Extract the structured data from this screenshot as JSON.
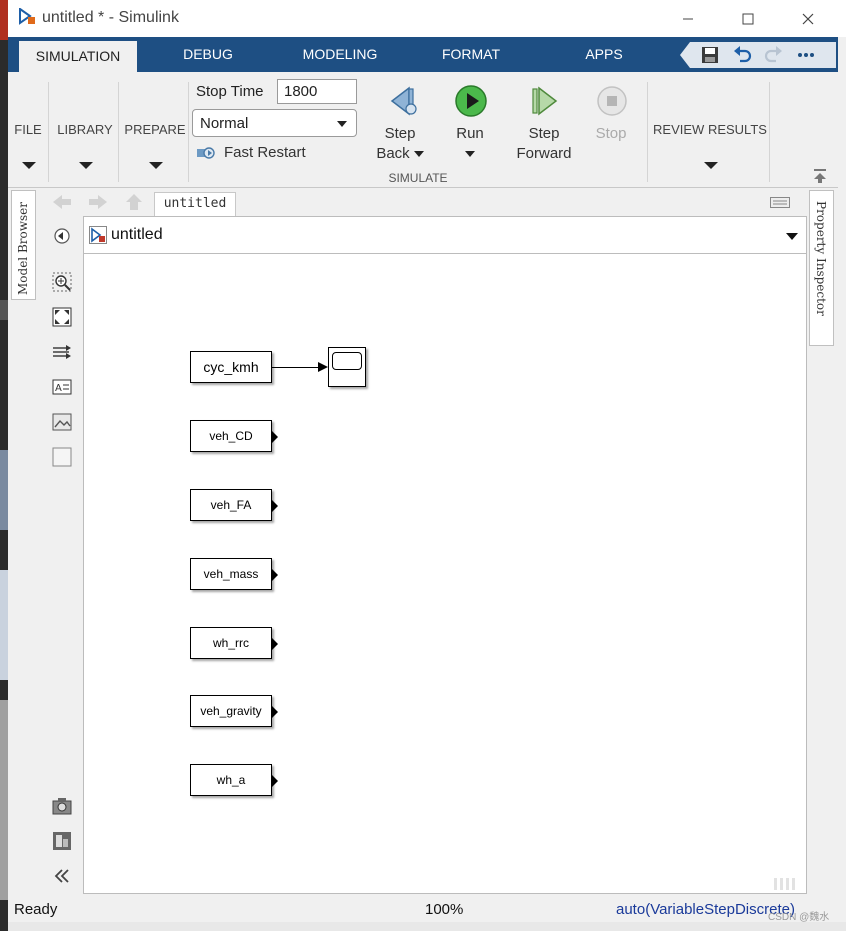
{
  "window": {
    "title": "untitled * - Simulink"
  },
  "tabs": [
    {
      "label": "SIMULATION",
      "active": true
    },
    {
      "label": "DEBUG",
      "active": false
    },
    {
      "label": "MODELING",
      "active": false
    },
    {
      "label": "FORMAT",
      "active": false
    },
    {
      "label": "APPS",
      "active": false
    }
  ],
  "quick_access": [
    "save-icon",
    "undo-icon",
    "redo-icon",
    "more-icon"
  ],
  "ribbon": {
    "file": "FILE",
    "library": "LIBRARY",
    "prepare": "PREPARE",
    "stop_time_label": "Stop Time",
    "stop_time_value": "1800",
    "sim_mode": "Normal",
    "fast_restart": "Fast Restart",
    "step_back": {
      "line1": "Step",
      "line2": "Back"
    },
    "run": {
      "line1": "Run"
    },
    "step_forward": {
      "line1": "Step",
      "line2": "Forward"
    },
    "stop": {
      "line1": "Stop"
    },
    "simulate_group": "SIMULATE",
    "review_results": "REVIEW RESULTS"
  },
  "side_panels": {
    "left": "Model Browser",
    "right": "Property Inspector"
  },
  "editor": {
    "doc_tab": "untitled",
    "address": "untitled"
  },
  "blocks": [
    {
      "label": "cyc_kmh",
      "type": "from-workspace"
    },
    {
      "label": "veh_CD",
      "type": "constant"
    },
    {
      "label": "veh_FA",
      "type": "constant"
    },
    {
      "label": "veh_mass",
      "type": "constant"
    },
    {
      "label": "wh_rrc",
      "type": "constant"
    },
    {
      "label": "veh_gravity",
      "type": "constant"
    },
    {
      "label": "wh_a",
      "type": "constant"
    }
  ],
  "statusbar": {
    "status": "Ready",
    "zoom": "100%",
    "solver": "auto(VariableStepDiscrete)"
  },
  "watermark": "CSDN @魏水",
  "colors": {
    "tab_strip": "#1e4f83",
    "run_green": "#3aa53a",
    "solver_link": "#1a3a9a"
  }
}
